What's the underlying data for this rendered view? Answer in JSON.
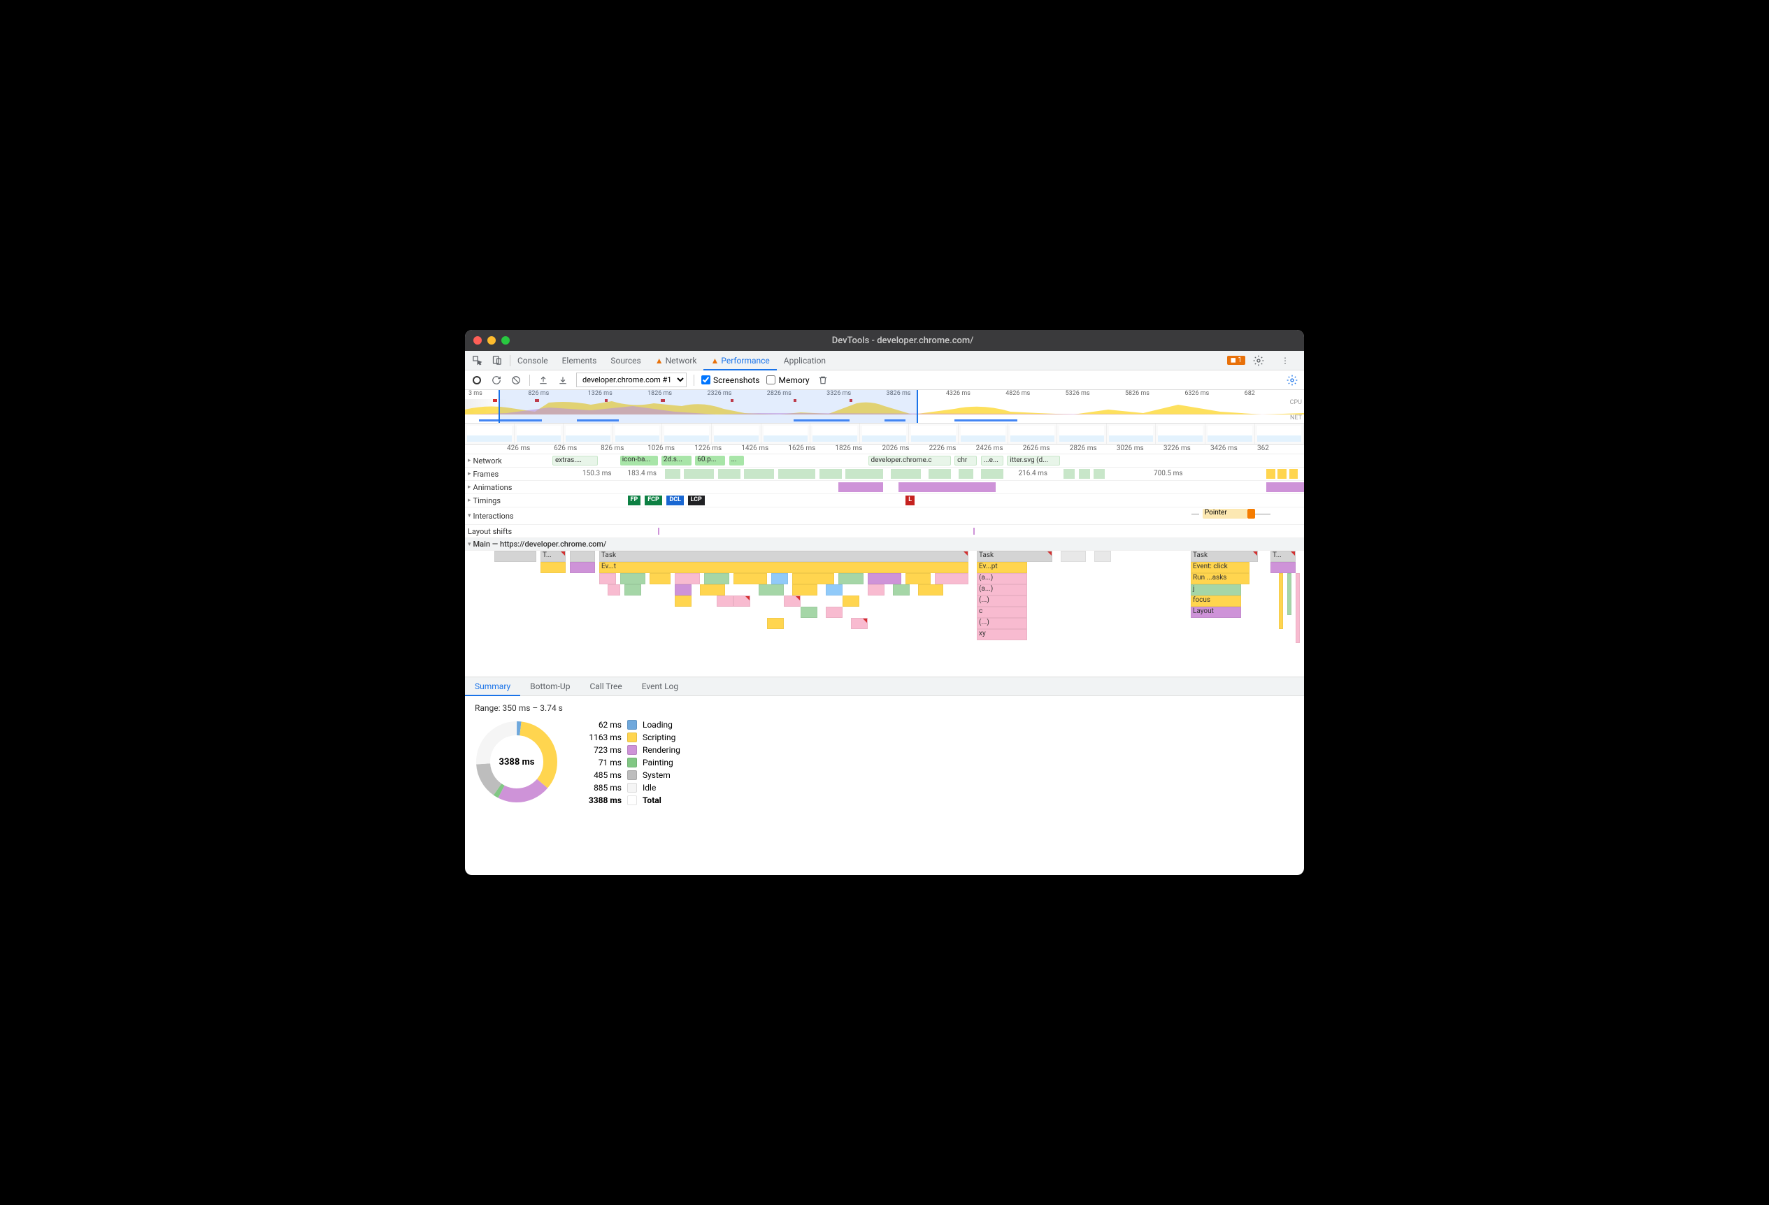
{
  "window": {
    "title": "DevTools - developer.chrome.com/"
  },
  "tabs": {
    "items": [
      "Console",
      "Elements",
      "Sources",
      "Network",
      "Performance",
      "Application"
    ],
    "warn_on": [
      "Network",
      "Performance"
    ],
    "active": "Performance",
    "issues_count": "1"
  },
  "toolbar": {
    "profile_select": "developer.chrome.com #1",
    "screenshots_checked": true,
    "screenshots_label": "Screenshots",
    "memory_checked": false,
    "memory_label": "Memory"
  },
  "overview": {
    "ruler_ms": [
      "3 ms",
      "826 ms",
      "1326 ms",
      "1826 ms",
      "2326 ms",
      "2826 ms",
      "3326 ms",
      "3826 ms",
      "4326 ms",
      "4826 ms",
      "5326 ms",
      "5826 ms",
      "6326 ms",
      "682"
    ],
    "cpu_label": "CPU",
    "net_label": "NET"
  },
  "main_ruler_ms": [
    "426 ms",
    "626 ms",
    "826 ms",
    "1026 ms",
    "1226 ms",
    "1426 ms",
    "1626 ms",
    "1826 ms",
    "2026 ms",
    "2226 ms",
    "2426 ms",
    "2626 ms",
    "2826 ms",
    "3026 ms",
    "3226 ms",
    "3426 ms",
    "362"
  ],
  "tracks": {
    "network": {
      "label": "Network",
      "items": [
        "extras....",
        "icon-ba...",
        "2d.s...",
        "60.p...",
        "...",
        "developer.chrome.c",
        "chr",
        "...e...",
        "itter.svg (d..."
      ]
    },
    "frames": {
      "label": "Frames",
      "times": [
        "150.3 ms",
        "183.4 ms",
        "216.4 ms",
        "700.5 ms"
      ]
    },
    "animations": {
      "label": "Animations"
    },
    "timings": {
      "label": "Timings",
      "badges": [
        "FP",
        "FCP",
        "DCL",
        "LCP",
        "L"
      ]
    },
    "interactions": {
      "label": "Interactions",
      "pointer_label": "Pointer"
    },
    "layout_shifts": {
      "label": "Layout shifts"
    },
    "main": {
      "label": "Main — https://developer.chrome.com/"
    }
  },
  "flame": {
    "top_tasks": [
      "T...",
      "Task",
      "Task",
      "Task",
      "T..."
    ],
    "col1": [
      "Ev...t"
    ],
    "col2": [
      "Ev...pt",
      "(a...)",
      "(a...)",
      "(...)",
      "c",
      "(...)",
      "xy"
    ],
    "col3": [
      "Event: click",
      "Run ...asks",
      "j",
      "focus",
      "Layout"
    ]
  },
  "bottom_tabs": {
    "items": [
      "Summary",
      "Bottom-Up",
      "Call Tree",
      "Event Log"
    ],
    "active": "Summary"
  },
  "summary": {
    "range_label": "Range: 350 ms – 3.74 s",
    "total_ms": "3388 ms",
    "categories": [
      {
        "time": "62 ms",
        "label": "Loading",
        "key": "loading"
      },
      {
        "time": "1163 ms",
        "label": "Scripting",
        "key": "scripting"
      },
      {
        "time": "723 ms",
        "label": "Rendering",
        "key": "rendering"
      },
      {
        "time": "71 ms",
        "label": "Painting",
        "key": "painting"
      },
      {
        "time": "485 ms",
        "label": "System",
        "key": "system"
      },
      {
        "time": "885 ms",
        "label": "Idle",
        "key": "idle"
      },
      {
        "time": "3388 ms",
        "label": "Total",
        "key": "total"
      }
    ]
  },
  "chart_data": {
    "type": "pie",
    "title": "Activity breakdown",
    "series": [
      {
        "name": "Loading",
        "value": 62,
        "color": "#6fa8dc"
      },
      {
        "name": "Scripting",
        "value": 1163,
        "color": "#ffd54f"
      },
      {
        "name": "Rendering",
        "value": 723,
        "color": "#ce93d8"
      },
      {
        "name": "Painting",
        "value": 71,
        "color": "#81c784"
      },
      {
        "name": "System",
        "value": 485,
        "color": "#bdbdbd"
      },
      {
        "name": "Idle",
        "value": 885,
        "color": "#f5f5f5"
      }
    ],
    "total": 3388,
    "unit": "ms"
  }
}
